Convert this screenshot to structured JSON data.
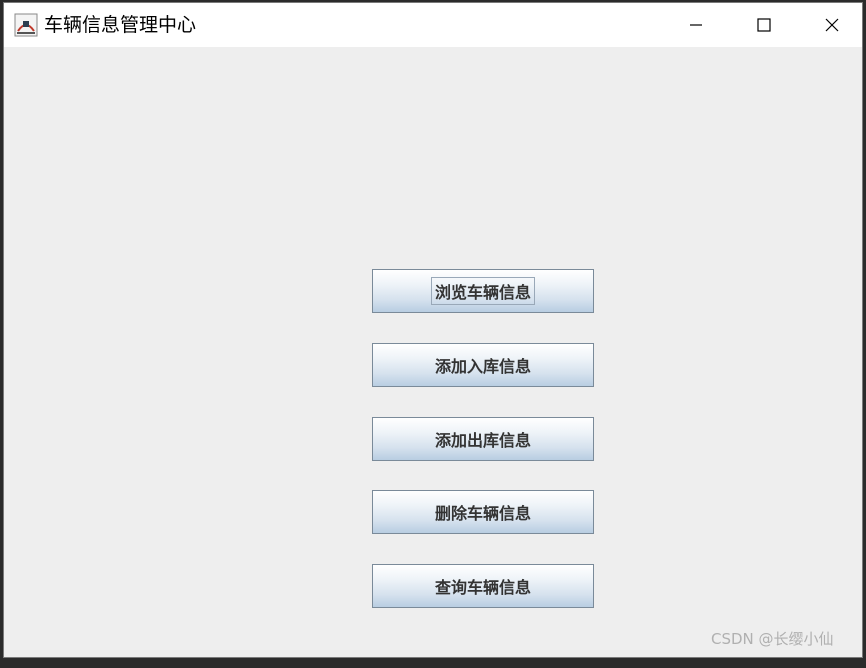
{
  "window": {
    "title": "车辆信息管理中心"
  },
  "icons": {
    "app": "java-app-icon",
    "minimize": "minimize-icon",
    "maximize": "maximize-icon",
    "close": "close-icon"
  },
  "menu": {
    "buttons": [
      {
        "label": "浏览车辆信息"
      },
      {
        "label": "添加入库信息"
      },
      {
        "label": "添加出库信息"
      },
      {
        "label": "删除车辆信息"
      },
      {
        "label": "查询车辆信息"
      }
    ]
  },
  "watermark": "CSDN @长缨小仙",
  "colors": {
    "window_bg": "#eeeeee",
    "titlebar_bg": "#ffffff",
    "button_border": "#7a8a99",
    "button_text": "#333333"
  }
}
